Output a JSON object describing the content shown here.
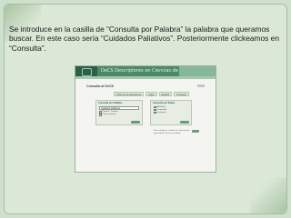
{
  "slide": {
    "caption": "Se introduce en la casilla de “Consulta por Palabra” la palabra que queramos buscar. En este caso sería “Cuidados Paliativos”. Posteriormente clickeamos en “Consulta”."
  },
  "screenshot": {
    "banner_text": "DeCS Descriptores en Ciencias de la Salud",
    "title": "Consulta al DeCS",
    "tabs": [
      "Índice de los descriptores",
      "Inglés",
      "Español",
      "Portugués"
    ],
    "left_panel": {
      "heading": "Consulta por Palabra",
      "input_value": "Cuidados Paliativos",
      "options": [
        "Palabra / Termino",
        "Término Exacto"
      ]
    },
    "right_panel": {
      "heading": "Consulta por Índice",
      "options": [
        "Alfabético",
        "Permutado",
        "Jerárquico"
      ]
    },
    "footnote": "Para configurar el idioma y el formato de presentación de los resultados"
  },
  "colors": {
    "slide_bg": "#cfe0cc",
    "banner_dark": "#2d5f46",
    "banner_mid": "#4b8a67"
  }
}
